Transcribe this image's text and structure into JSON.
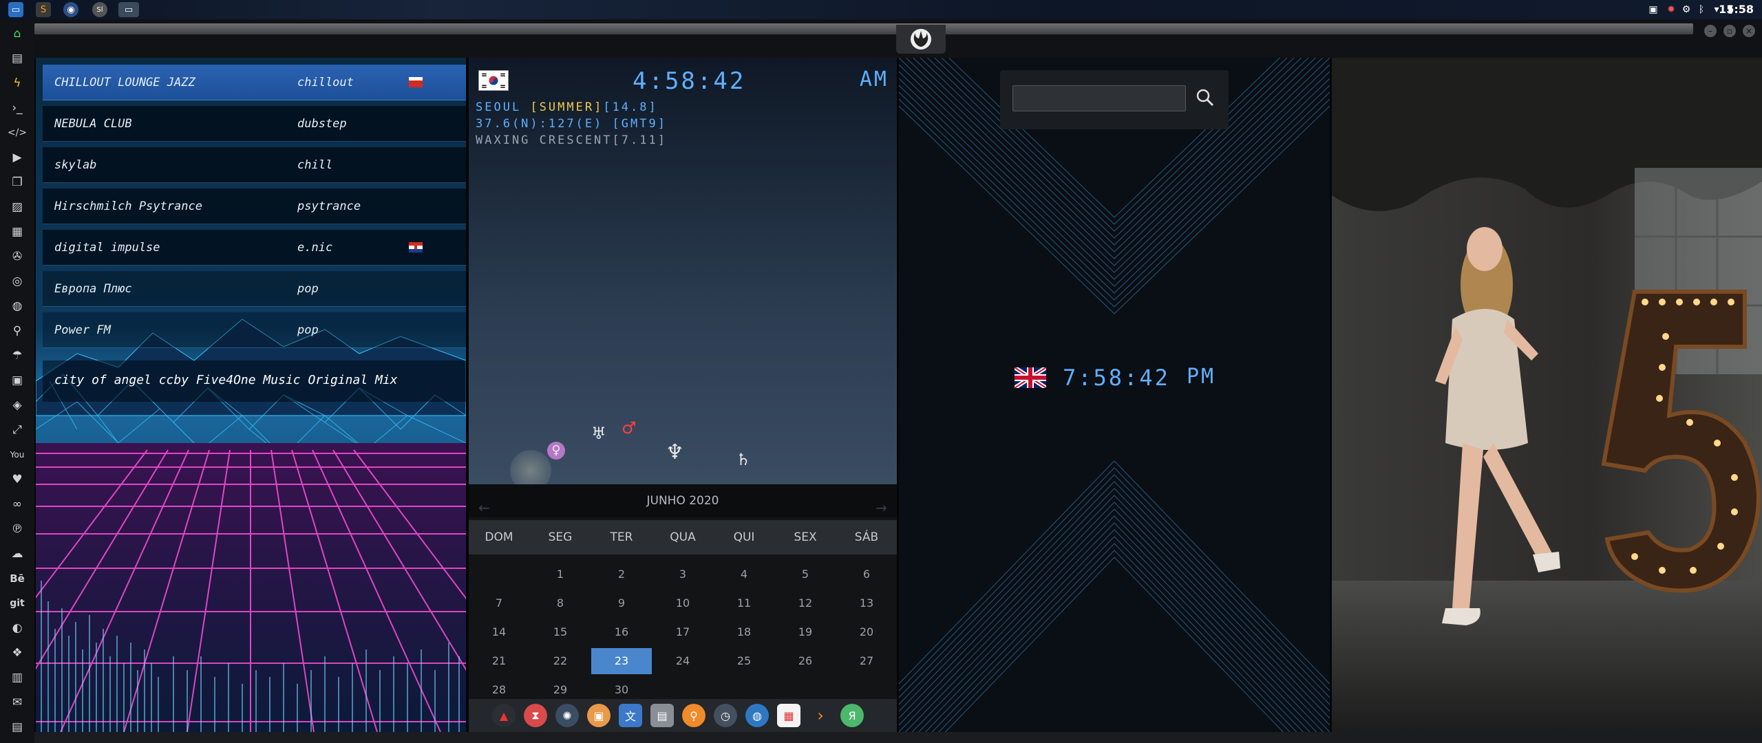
{
  "system": {
    "clock": "15:58"
  },
  "radio": {
    "stations": [
      {
        "name": "CHILLOUT LOUNGE JAZZ",
        "genre": "chillout",
        "flag": "russia",
        "active": true
      },
      {
        "name": "NEBULA CLUB",
        "genre": "dubstep",
        "flag": "",
        "active": false
      },
      {
        "name": "skylab",
        "genre": "chill",
        "flag": "",
        "active": false
      },
      {
        "name": "Hirschmilch Psytrance",
        "genre": "psytrance",
        "flag": "",
        "active": false
      },
      {
        "name": "digital impulse",
        "genre": "e.nic",
        "flag": "croatia",
        "active": false
      },
      {
        "name": "Европа Плюс",
        "genre": "pop",
        "flag": "",
        "active": false
      },
      {
        "name": "Power FM",
        "genre": "pop",
        "flag": "",
        "active": false
      }
    ],
    "now_playing": "city of angel ccby Five4One Music Original Mix"
  },
  "seoul": {
    "time": "4:58:42",
    "ampm": "AM",
    "line1_city": "SEOUL",
    "line1_season": "[SUMMER]",
    "line1_temp": "[14.8]",
    "line2": "37.6(N):127(E) [GMT9]",
    "line3": "WAXING CRESCENT[7.11]",
    "planets": [
      "♀",
      "♅",
      "♂",
      "♆",
      "♄"
    ]
  },
  "calendar": {
    "title": "JUNHO 2020",
    "weekdays": [
      "DOM",
      "SEG",
      "TER",
      "QUA",
      "QUI",
      "SEX",
      "SÁB"
    ],
    "weeks": [
      [
        "",
        "1",
        "2",
        "3",
        "4",
        "5",
        "6"
      ],
      [
        "7",
        "8",
        "9",
        "10",
        "11",
        "12",
        "13"
      ],
      [
        "14",
        "15",
        "16",
        "17",
        "18",
        "19",
        "20"
      ],
      [
        "21",
        "22",
        "23",
        "24",
        "25",
        "26",
        "27"
      ],
      [
        "28",
        "29",
        "30",
        "",
        "",
        "",
        ""
      ]
    ],
    "today": "23"
  },
  "london": {
    "time": "7:58:42",
    "ampm": "PM"
  },
  "colors": {
    "lcd": "#5fb0ff",
    "accent": "#4a86cc",
    "active_row": "#2b63b3"
  }
}
